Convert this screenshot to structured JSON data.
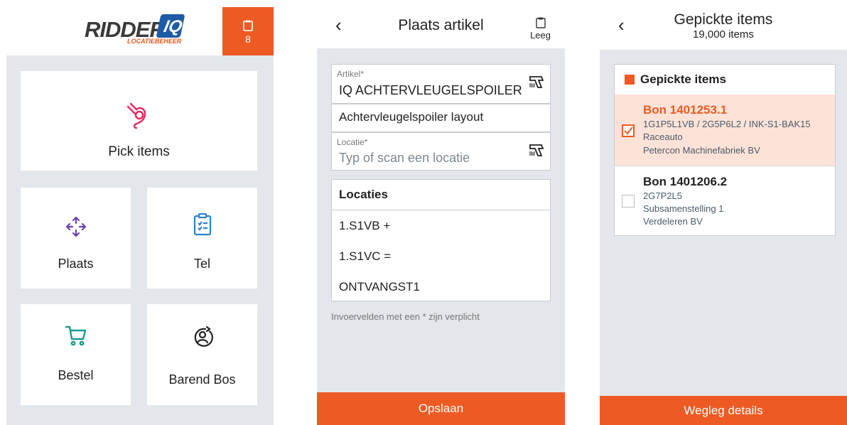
{
  "home": {
    "logo_text": "RIDDER",
    "logo_box": "IQ",
    "logo_sub": "LOCATIEBEHEER",
    "cart_count": "8",
    "tiles": [
      {
        "label": "Pick items",
        "icon": "pick-hand-icon",
        "color": "#e8265e"
      },
      {
        "label": "Plaats",
        "icon": "move-arrows-icon",
        "color": "#6f3fb6"
      },
      {
        "label": "Tel",
        "icon": "clipboard-list-icon",
        "color": "#2a7fd4"
      },
      {
        "label": "Bestel",
        "icon": "shopping-cart-icon",
        "color": "#1a9c8c"
      },
      {
        "label": "Barend Bos",
        "icon": "user-circle-icon",
        "color": "#222222"
      }
    ]
  },
  "place": {
    "back": "‹",
    "title": "Plaats artikel",
    "leeg": "Leeg",
    "artikel_label": "Artikel*",
    "artikel_value": "IQ ACHTERVLEUGELSPOILER LAYOUT",
    "description": "Achtervleugelspoiler layout",
    "locatie_label": "Locatie*",
    "locatie_placeholder": "Typ of scan een locatie",
    "locaties_header": "Locaties",
    "locaties": [
      "1.S1VB +",
      "1.S1VC =",
      "ONTVANGST1"
    ],
    "note": "Invoervelden met een * zijn verplicht",
    "save": "Opslaan"
  },
  "picked": {
    "back": "‹",
    "title": "Gepickte items",
    "subtitle": "19,000 items",
    "list_header": "Gepickte items",
    "orders": [
      {
        "bon": "Bon 1401253.1",
        "codes": "1G1P5L1VB / 2G5P6L2 / INK-S1-BAK15",
        "line2": "Raceauto",
        "line3": "Petercon Machinefabriek BV",
        "selected": true
      },
      {
        "bon": "Bon 1401206.2",
        "codes": "2G7P2L5",
        "line2": "Subsamenstelling 1",
        "line3": "Verdeleren BV",
        "selected": false
      }
    ],
    "details": "Wegleg details"
  },
  "colors": {
    "accent": "#ee5a24",
    "background": "#e3e6ea"
  }
}
